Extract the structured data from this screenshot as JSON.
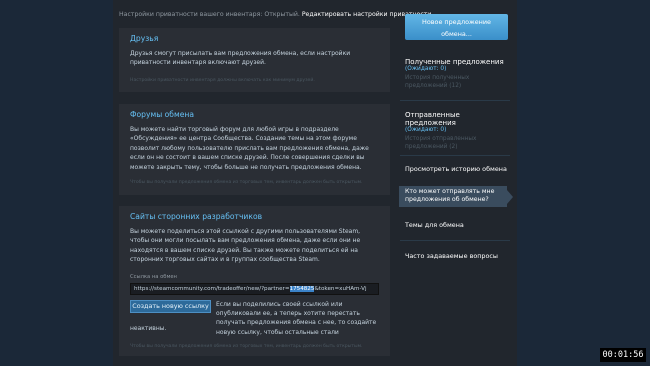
{
  "privacy": {
    "text": "Настройки приватности вашего инвентаря: Открытый.",
    "link": "Редактировать настройки приватности"
  },
  "friends_box": {
    "title": "Друзья",
    "text": "Друзья смогут присылать вам предложения обмена, если настройки приватности инвентаря включают друзей.",
    "note": "Настройки приватности инвентаря должны включать как минимум друзей."
  },
  "forums_box": {
    "title": "Форумы обмена",
    "text": "Вы можете найти торговый форум для любой игры в подразделе «Обсуждения» ее центра Сообщества. Создание темы на этом форуме позволит любому пользователю прислать вам предложения обмена, даже если он не состоит в вашем списке друзей. После совершения сделки вы можете закрыть тему, чтобы больше не получать предложения обмена.",
    "note": "Чтобы вы получали предложения обмена из торговых тем, инвентарь должен быть открытым."
  },
  "third_party_box": {
    "title": "Сайты сторонних разработчиков",
    "text": "Вы можете поделиться этой ссылкой с другими пользователями Steam, чтобы они могли посылать вам предложения обмена, даже если они не находятся в вашем списке друзей. Вы также можете поделиться ей на сторонних торговых сайтах и в группах сообщества Steam.",
    "url_label": "Ссылка на обмен",
    "url_prefix": "https://steamcommunity.com/tradeoffer/new/?partner=",
    "url_highlight": "1754825",
    "url_suffix": "&token=xuHAm-Vj",
    "new_link_button": "Создать новую ссылку",
    "new_link_text": "Если вы поделились своей ссылкой или опубликовали ее, а теперь хотите перестать получать предложения обмена с нее, то создайте новую ссылку, чтобы остальные стали",
    "new_link_tail": "неактивны.",
    "note": "Чтобы вы получали предложения обмена из торговых тем, инвентарь должен быть открытым."
  },
  "sidebar": {
    "new_offer_button_line1": "Новое предложение",
    "new_offer_button_line2": "обмена...",
    "received": {
      "title": "Полученные предложения",
      "sub": "(Ожидают: 0)",
      "history": "История полученных предложений (12)"
    },
    "sent": {
      "title": "Отправленные предложения",
      "sub": "(Ожидают: 0)",
      "history": "История отправленных предложений (2)"
    },
    "history_link": "Просмотреть историю обмена",
    "who_can_send_line1": "Кто может отправлять мне",
    "who_can_send_line2": "предложения об обмене?",
    "trade_topics": "Темы для обмена",
    "faq": "Часто задаваемые вопросы"
  },
  "timer": "00:01:56"
}
